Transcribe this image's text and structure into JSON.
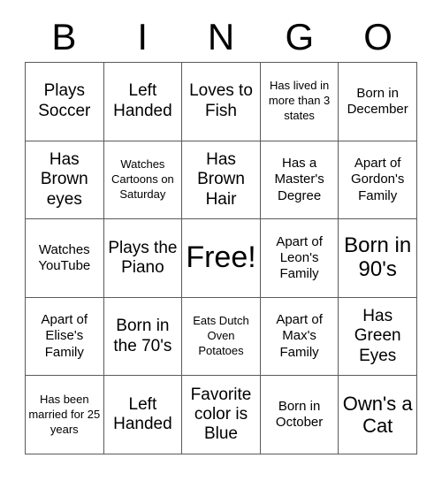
{
  "card": {
    "title": "BINGO",
    "header_letters": [
      "B",
      "I",
      "N",
      "G",
      "O"
    ],
    "columns": 5,
    "rows": 5,
    "border_color": "#5a5a5a",
    "text_color": "#000000",
    "background_color": "#ffffff",
    "free_space": {
      "row": 3,
      "column": 3,
      "label": "Free!"
    },
    "cells": [
      [
        {
          "text": "Plays Soccer",
          "size": "md"
        },
        {
          "text": "Left Handed",
          "size": "md"
        },
        {
          "text": "Loves to Fish",
          "size": "md"
        },
        {
          "text": "Has lived in more than 3 states",
          "size": "xs"
        },
        {
          "text": "Born in December",
          "size": "sm"
        }
      ],
      [
        {
          "text": "Has Brown eyes",
          "size": "md"
        },
        {
          "text": "Watches Cartoons on Saturday",
          "size": "xs"
        },
        {
          "text": "Has Brown Hair",
          "size": "md"
        },
        {
          "text": "Has a Master's Degree",
          "size": "sm"
        },
        {
          "text": "Apart of Gordon's Family",
          "size": "sm"
        }
      ],
      [
        {
          "text": "Watches YouTube",
          "size": "sm"
        },
        {
          "text": "Plays the Piano",
          "size": "md"
        },
        {
          "text": "Free!",
          "size": "free"
        },
        {
          "text": "Apart of Leon's Family",
          "size": "sm"
        },
        {
          "text": "Born in 90's",
          "size": "xl"
        }
      ],
      [
        {
          "text": "Apart of Elise's Family",
          "size": "sm"
        },
        {
          "text": "Born in the 70's",
          "size": "md"
        },
        {
          "text": "Eats Dutch Oven Potatoes",
          "size": "xs"
        },
        {
          "text": "Apart of Max's Family",
          "size": "sm"
        },
        {
          "text": "Has Green Eyes",
          "size": "md"
        }
      ],
      [
        {
          "text": "Has been married for 25 years",
          "size": "xs"
        },
        {
          "text": "Left Handed",
          "size": "md"
        },
        {
          "text": "Favorite color is Blue",
          "size": "md"
        },
        {
          "text": "Born in October",
          "size": "sm"
        },
        {
          "text": "Own's a Cat",
          "size": "lg"
        }
      ]
    ]
  }
}
